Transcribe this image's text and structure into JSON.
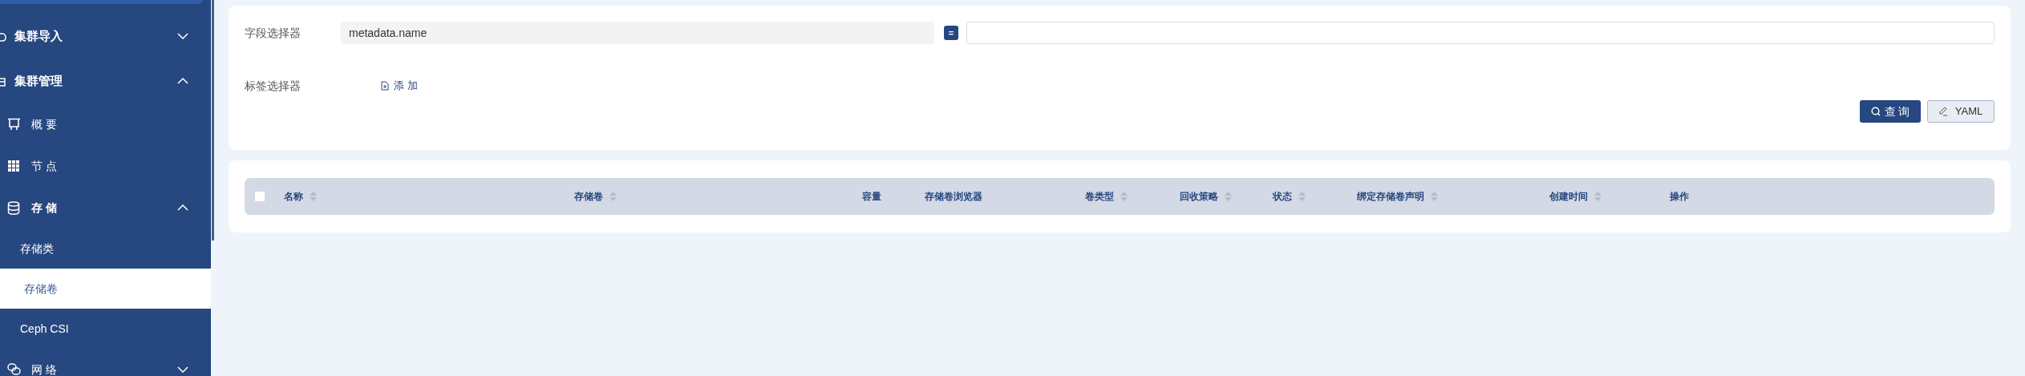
{
  "sidebar": {
    "items": [
      {
        "label": "集群导入",
        "expanded": false
      },
      {
        "label": "集群管理",
        "expanded": true,
        "children": [
          {
            "label": "概要"
          },
          {
            "label": "节点"
          },
          {
            "label": "存储",
            "expanded": true,
            "children": [
              {
                "label": "存储类",
                "selected": false
              },
              {
                "label": "存储卷",
                "selected": true
              },
              {
                "label": "Ceph CSI",
                "selected": false
              }
            ]
          },
          {
            "label": "网络",
            "expanded": false
          }
        ]
      }
    ]
  },
  "filters": {
    "field_selector": {
      "label": "字段选择器",
      "value": "metadata.name",
      "operator": "="
    },
    "label_selector": {
      "label": "标签选择器",
      "add": "添 加"
    },
    "buttons": [
      {
        "label": "查 询",
        "kind": "primary"
      },
      {
        "label": "YAML",
        "kind": "secondary"
      }
    ]
  },
  "table": {
    "select_all": {
      "checked": false
    },
    "columns": [
      {
        "label": "名称",
        "sortable": true
      },
      {
        "label": "存储卷",
        "sortable": true
      },
      {
        "label": "容量",
        "sortable": false
      },
      {
        "label": "存储卷浏览器",
        "sortable": false
      },
      {
        "label": "卷类型",
        "sortable": true
      },
      {
        "label": "回收策略",
        "sortable": true
      },
      {
        "label": "状态",
        "sortable": true
      },
      {
        "label": "绑定存储卷声明",
        "sortable": true
      },
      {
        "label": "创建时间",
        "sortable": true
      },
      {
        "label": "操作",
        "sortable": false
      }
    ]
  }
}
